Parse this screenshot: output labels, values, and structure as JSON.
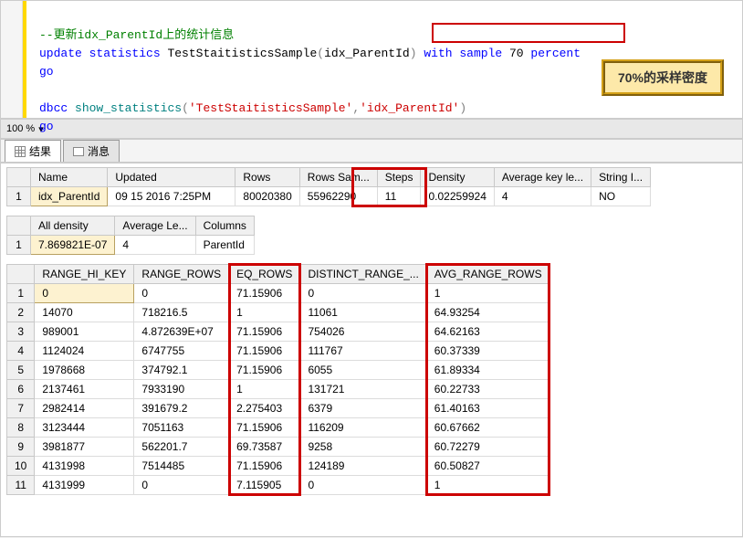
{
  "editor": {
    "line1_comment_prefix": "--",
    "line1_comment": "更新idx_ParentId上的统计信息",
    "line2_update": "update",
    "line2_statistics": "statistics",
    "line2_obj": "TestStaitisticsSample",
    "line2_paren_open": "(",
    "line2_idx": "idx_ParentId",
    "line2_paren_close": ")",
    "line2_with": "with",
    "line2_sample": "sample",
    "line2_num": "70",
    "line2_percent": "percent",
    "line3_go": "go",
    "line5_dbcc": "dbcc",
    "line5_show": "show_statistics",
    "line5_p1": "(",
    "line5_s1": "'TestStaitisticsSample'",
    "line5_comma": ",",
    "line5_s2": "'idx_ParentId'",
    "line5_p2": ")",
    "line6_go": "go"
  },
  "callout": "70%的采样密度",
  "zoom": "100 %",
  "tabs": {
    "results": "结果",
    "messages": "消息"
  },
  "grid1": {
    "headers": [
      "Name",
      "Updated",
      "Rows",
      "Rows Sam...",
      "Steps",
      "Density",
      "Average key le...",
      "String I..."
    ],
    "rows": [
      [
        "idx_ParentId",
        "09 15 2016  7:25PM",
        "80020380",
        "55962290",
        "11",
        "0.02259924",
        "4",
        "NO"
      ]
    ]
  },
  "grid2": {
    "headers": [
      "All density",
      "Average Le...",
      "Columns"
    ],
    "rows": [
      [
        "7.869821E-07",
        "4",
        "ParentId"
      ]
    ]
  },
  "grid3": {
    "headers": [
      "RANGE_HI_KEY",
      "RANGE_ROWS",
      "EQ_ROWS",
      "DISTINCT_RANGE_...",
      "AVG_RANGE_ROWS"
    ],
    "rows": [
      [
        "0",
        "0",
        "71.15906",
        "0",
        "1"
      ],
      [
        "14070",
        "718216.5",
        "1",
        "11061",
        "64.93254"
      ],
      [
        "989001",
        "4.872639E+07",
        "71.15906",
        "754026",
        "64.62163"
      ],
      [
        "1124024",
        "6747755",
        "71.15906",
        "111767",
        "60.37339"
      ],
      [
        "1978668",
        "374792.1",
        "71.15906",
        "6055",
        "61.89334"
      ],
      [
        "2137461",
        "7933190",
        "1",
        "131721",
        "60.22733"
      ],
      [
        "2982414",
        "391679.2",
        "2.275403",
        "6379",
        "61.40163"
      ],
      [
        "3123444",
        "7051163",
        "71.15906",
        "116209",
        "60.67662"
      ],
      [
        "3981877",
        "562201.7",
        "69.73587",
        "9258",
        "60.72279"
      ],
      [
        "4131998",
        "7514485",
        "71.15906",
        "124189",
        "60.50827"
      ],
      [
        "4131999",
        "0",
        "7.115905",
        "0",
        "1"
      ]
    ]
  }
}
